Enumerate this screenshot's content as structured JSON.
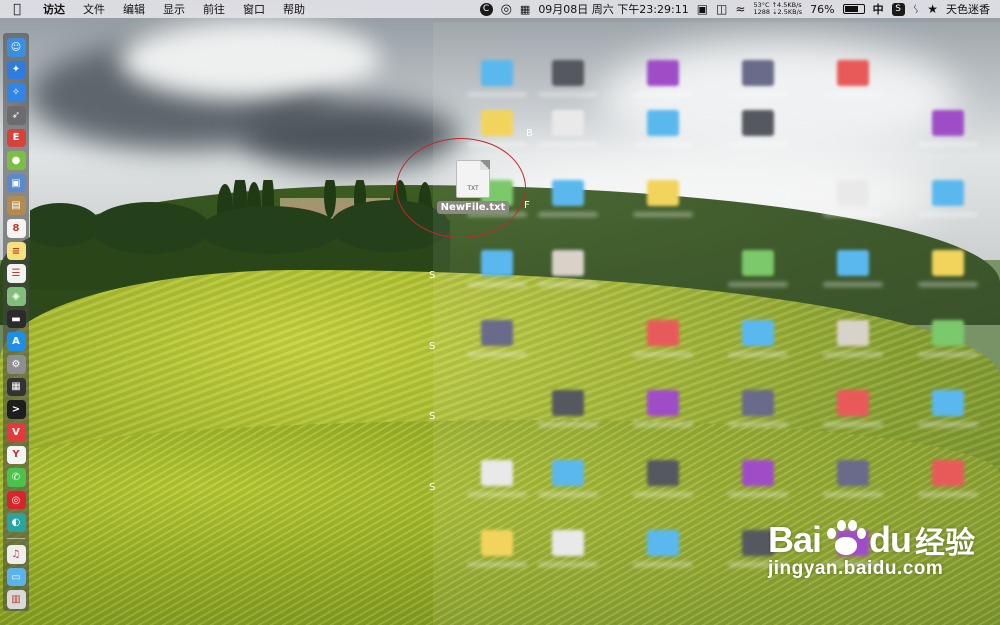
{
  "menubar": {
    "apple_icon": "apple-logo-icon",
    "items": [
      "访达",
      "文件",
      "编辑",
      "显示",
      "前往",
      "窗口",
      "帮助"
    ]
  },
  "status": {
    "app_c": "C",
    "datetime": "09月08日 周六 下午23:29:11",
    "temperature": "53°C",
    "cpu": "1288",
    "net_up": "↑4.5KB/s",
    "net_down": "⇣2.5KB/s",
    "battery": "76%",
    "battery_level": 0.76,
    "input_method": "中",
    "app_s": "S",
    "user": "天色迷香"
  },
  "dock": {
    "items": [
      {
        "name": "finder",
        "color": "#3b8fe0",
        "glyph": "☺"
      },
      {
        "name": "app-store-blue",
        "color": "#2d7de0",
        "glyph": "✦"
      },
      {
        "name": "safari",
        "color": "#2f86e8",
        "glyph": "✧"
      },
      {
        "name": "launchpad",
        "color": "#6b6b70",
        "glyph": "➶"
      },
      {
        "name": "flashcards",
        "color": "#d7423a",
        "glyph": "E"
      },
      {
        "name": "android-emulator",
        "color": "#7cc043",
        "glyph": "●"
      },
      {
        "name": "preview",
        "color": "#5b89c9",
        "glyph": "▣"
      },
      {
        "name": "notes-book",
        "color": "#b58a4f",
        "glyph": "▤"
      },
      {
        "name": "calendar",
        "color": "#f4f4f4",
        "glyph": "8"
      },
      {
        "name": "notes",
        "color": "#f6e27c",
        "glyph": "≡"
      },
      {
        "name": "reminders",
        "color": "#f2f2f2",
        "glyph": "☰"
      },
      {
        "name": "maps",
        "color": "#7fbf7a",
        "glyph": "◈"
      },
      {
        "name": "activity-monitor",
        "color": "#2b2b2b",
        "glyph": "▬"
      },
      {
        "name": "app-store",
        "color": "#1d8fe8",
        "glyph": "A"
      },
      {
        "name": "system-preferences",
        "color": "#8e8e93",
        "glyph": "⚙"
      },
      {
        "name": "console",
        "color": "#333333",
        "glyph": "▦"
      },
      {
        "name": "terminal",
        "color": "#1e1e1e",
        "glyph": ">"
      },
      {
        "name": "vivaldi",
        "color": "#e5393a",
        "glyph": "V"
      },
      {
        "name": "yandex",
        "color": "#f4f4f4",
        "glyph": "Y"
      },
      {
        "name": "wechat",
        "color": "#4bc24a",
        "glyph": "✆"
      },
      {
        "name": "netease-music",
        "color": "#d8252c",
        "glyph": "◎"
      },
      {
        "name": "teamviewer",
        "color": "#2aa4a0",
        "glyph": "◐"
      }
    ],
    "after_separator": [
      {
        "name": "itunes-file",
        "color": "#eeeeee",
        "glyph": "♫"
      },
      {
        "name": "downloads-folder",
        "color": "#59b3ec",
        "glyph": "▭"
      },
      {
        "name": "trash",
        "color": "#d9d9d9",
        "glyph": "▥"
      }
    ]
  },
  "file": {
    "tag": "TXT",
    "label": "NewFile.txt"
  },
  "edge_chars": [
    "B",
    "F",
    "S",
    "S",
    "S",
    "S"
  ],
  "watermark": {
    "brand_left": "Bai",
    "brand_right": "du",
    "jingyan": "经验",
    "url": "jingyan.baidu.com"
  }
}
